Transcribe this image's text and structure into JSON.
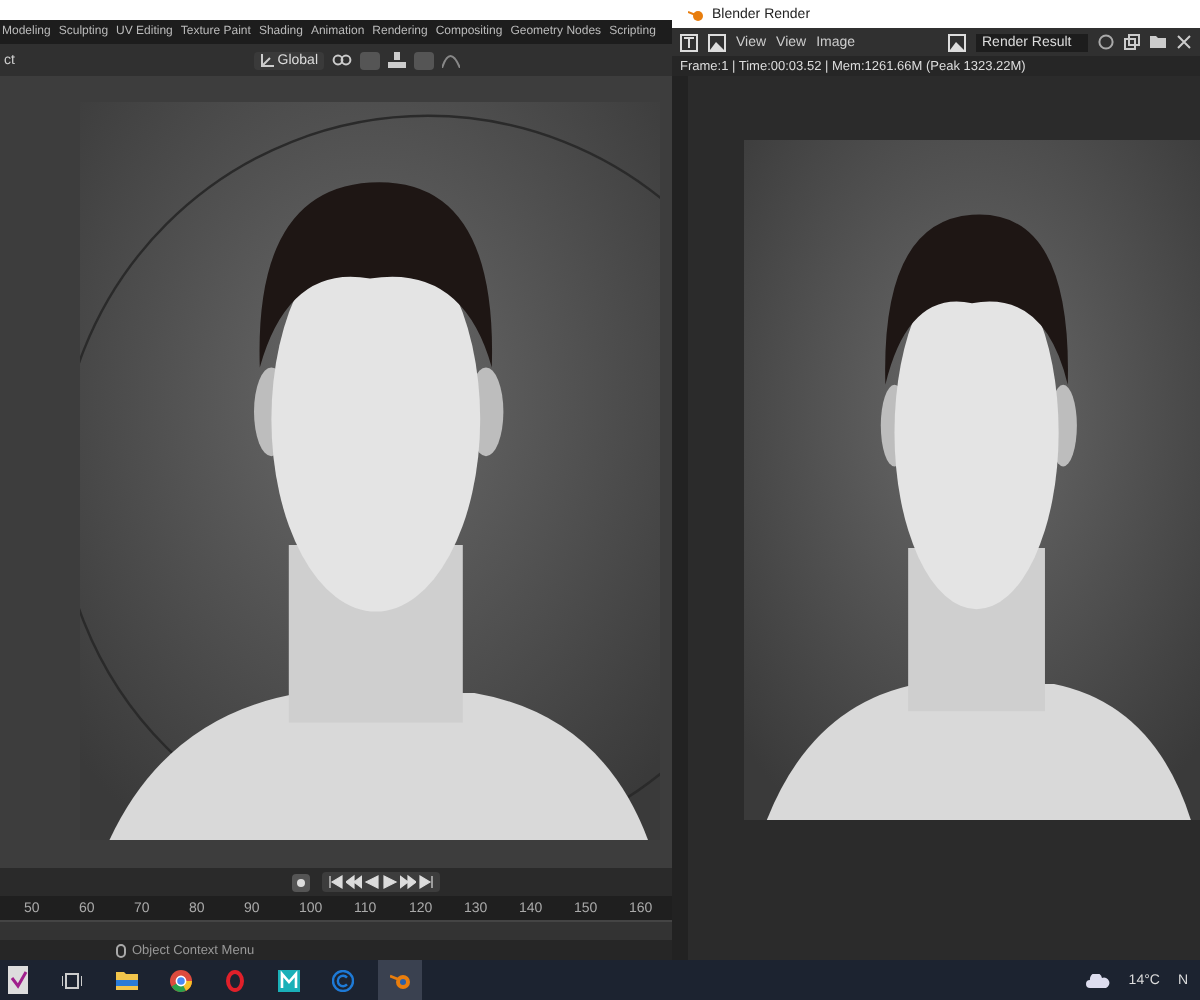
{
  "workspace_tabs": [
    "Modeling",
    "Sculpting",
    "UV Editing",
    "Texture Paint",
    "Shading",
    "Animation",
    "Rendering",
    "Compositing",
    "Geometry Nodes",
    "Scripting"
  ],
  "header": {
    "left_text": "ct",
    "orientation": "Global"
  },
  "timeline": {
    "frames": [
      "50",
      "60",
      "70",
      "80",
      "90",
      "100",
      "110",
      "120",
      "130",
      "140",
      "150",
      "160"
    ]
  },
  "status_bar": {
    "hint": "Object Context Menu"
  },
  "render_window": {
    "title": "Blender Render",
    "menus": [
      "View",
      "View",
      "Image"
    ],
    "image_name": "Render Result",
    "info": "Frame:1 | Time:00:03.52 | Mem:1261.66M (Peak 1323.22M)"
  },
  "taskbar": {
    "weather": "14°C",
    "edge_text": "N"
  }
}
